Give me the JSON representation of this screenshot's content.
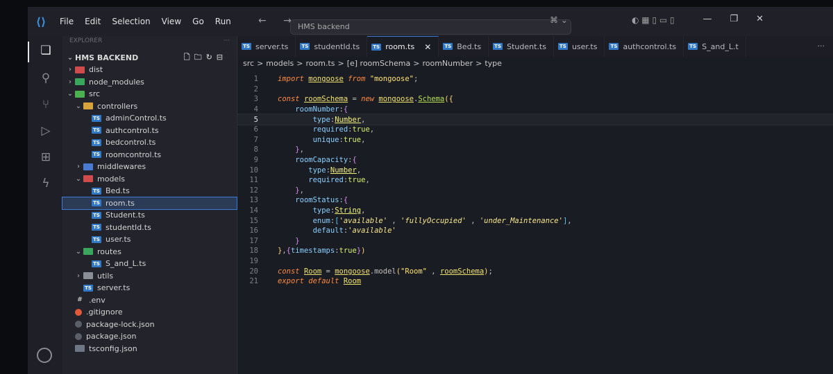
{
  "menu": [
    "File",
    "Edit",
    "Selection",
    "View",
    "Go",
    "Run"
  ],
  "titlebar": {
    "search_text": "HMS backend",
    "nav": "← →"
  },
  "sidebar": {
    "header": "EXPLORER",
    "more": "···",
    "root": "HMS BACKEND",
    "tree": [
      {
        "label": "dist",
        "depth": 0,
        "chev": "›",
        "icon": "folder red"
      },
      {
        "label": "node_modules",
        "depth": 0,
        "chev": "›",
        "icon": "folder green"
      },
      {
        "label": "src",
        "depth": 0,
        "chev": "⌄",
        "icon": "folder src"
      },
      {
        "label": "controllers",
        "depth": 1,
        "chev": "⌄",
        "icon": "folder yellow"
      },
      {
        "label": "adminControl.ts",
        "depth": 2,
        "chev": "",
        "icon": "ts"
      },
      {
        "label": "authcontrol.ts",
        "depth": 2,
        "chev": "",
        "icon": "ts"
      },
      {
        "label": "bedcontrol.ts",
        "depth": 2,
        "chev": "",
        "icon": "ts"
      },
      {
        "label": "roomcontrol.ts",
        "depth": 2,
        "chev": "",
        "icon": "ts"
      },
      {
        "label": "middlewares",
        "depth": 1,
        "chev": "›",
        "icon": "folder blue"
      },
      {
        "label": "models",
        "depth": 1,
        "chev": "⌄",
        "icon": "folder red"
      },
      {
        "label": "Bed.ts",
        "depth": 2,
        "chev": "",
        "icon": "ts"
      },
      {
        "label": "room.ts",
        "depth": 2,
        "chev": "",
        "icon": "ts",
        "selected": true
      },
      {
        "label": "Student.ts",
        "depth": 2,
        "chev": "",
        "icon": "ts"
      },
      {
        "label": "studentId.ts",
        "depth": 2,
        "chev": "",
        "icon": "ts"
      },
      {
        "label": "user.ts",
        "depth": 2,
        "chev": "",
        "icon": "ts"
      },
      {
        "label": "routes",
        "depth": 1,
        "chev": "⌄",
        "icon": "folder green"
      },
      {
        "label": "S_and_L.ts",
        "depth": 2,
        "chev": "",
        "icon": "ts"
      },
      {
        "label": "utils",
        "depth": 1,
        "chev": "›",
        "icon": "folder gray"
      },
      {
        "label": "server.ts",
        "depth": 1,
        "chev": "",
        "icon": "ts"
      },
      {
        "label": ".env",
        "depth": 0,
        "chev": "",
        "icon": "env"
      },
      {
        "label": ".gitignore",
        "depth": 0,
        "chev": "",
        "icon": "git"
      },
      {
        "label": "package-lock.json",
        "depth": 0,
        "chev": "",
        "icon": "json"
      },
      {
        "label": "package.json",
        "depth": 0,
        "chev": "",
        "icon": "json"
      },
      {
        "label": "tsconfig.json",
        "depth": 0,
        "chev": "",
        "icon": "cfg"
      }
    ]
  },
  "tabs": [
    {
      "label": "server.ts",
      "active": false
    },
    {
      "label": "studentId.ts",
      "active": false
    },
    {
      "label": "room.ts",
      "active": true
    },
    {
      "label": "Bed.ts",
      "active": false
    },
    {
      "label": "Student.ts",
      "active": false
    },
    {
      "label": "user.ts",
      "active": false
    },
    {
      "label": "authcontrol.ts",
      "active": false
    },
    {
      "label": "S_and_L.t",
      "active": false
    }
  ],
  "tab_close": "✕",
  "tab_more": "···",
  "breadcrumb": [
    "src",
    ">",
    "models",
    ">",
    "room.ts",
    ">",
    "[e] roomSchema",
    ">",
    "roomNumber",
    ">",
    "type"
  ],
  "editor": {
    "current_line": 5,
    "lines": [
      [
        [
          "kw",
          "import "
        ],
        [
          "var",
          "mongoose"
        ],
        [
          "kw",
          " from "
        ],
        [
          "str",
          "\"mongoose\""
        ],
        [
          "pun",
          ";"
        ]
      ],
      [],
      [
        [
          "kw",
          "const "
        ],
        [
          "var",
          "roomSchema"
        ],
        [
          "pun",
          " = "
        ],
        [
          "kw",
          "new "
        ],
        [
          "var",
          "mongoose"
        ],
        [
          "pun",
          "."
        ],
        [
          "fn",
          "Schema"
        ],
        [
          "brace",
          "({"
        ]
      ],
      [
        [
          "pun",
          "    "
        ],
        [
          "key",
          "roomNumber"
        ],
        [
          "pun",
          ":"
        ],
        [
          "brace2",
          "{"
        ]
      ],
      [
        [
          "pun",
          "        "
        ],
        [
          "key",
          "type"
        ],
        [
          "pun",
          ":"
        ],
        [
          "type",
          "Number"
        ],
        [
          "pun",
          ","
        ]
      ],
      [
        [
          "pun",
          "        "
        ],
        [
          "key",
          "required"
        ],
        [
          "pun",
          ":"
        ],
        [
          "bool",
          "true"
        ],
        [
          "pun",
          ","
        ]
      ],
      [
        [
          "pun",
          "        "
        ],
        [
          "key",
          "unique"
        ],
        [
          "pun",
          ":"
        ],
        [
          "bool",
          "true"
        ],
        [
          "pun",
          ","
        ]
      ],
      [
        [
          "pun",
          "    "
        ],
        [
          "brace2",
          "}"
        ],
        [
          "pun",
          ","
        ]
      ],
      [
        [
          "pun",
          "    "
        ],
        [
          "key",
          "roomCapacity"
        ],
        [
          "pun",
          ":"
        ],
        [
          "brace2",
          "{"
        ]
      ],
      [
        [
          "pun",
          "       "
        ],
        [
          "key",
          "type"
        ],
        [
          "pun",
          ":"
        ],
        [
          "type",
          "Number"
        ],
        [
          "pun",
          ","
        ]
      ],
      [
        [
          "pun",
          "       "
        ],
        [
          "key",
          "required"
        ],
        [
          "pun",
          ":"
        ],
        [
          "bool",
          "true"
        ],
        [
          "pun",
          ","
        ]
      ],
      [
        [
          "pun",
          "    "
        ],
        [
          "brace2",
          "}"
        ],
        [
          "pun",
          ","
        ]
      ],
      [
        [
          "pun",
          "    "
        ],
        [
          "key",
          "roomStatus"
        ],
        [
          "pun",
          ":"
        ],
        [
          "brace2",
          "{"
        ]
      ],
      [
        [
          "pun",
          "        "
        ],
        [
          "key",
          "type"
        ],
        [
          "pun",
          ":"
        ],
        [
          "type",
          "String"
        ],
        [
          "pun",
          ","
        ]
      ],
      [
        [
          "pun",
          "        "
        ],
        [
          "key",
          "enum"
        ],
        [
          "pun",
          ":"
        ],
        [
          "brace3",
          "["
        ],
        [
          "strq",
          "'available'"
        ],
        [
          "pun",
          " , "
        ],
        [
          "strq",
          "'fullyOccupied'"
        ],
        [
          "pun",
          " , "
        ],
        [
          "strq",
          "'under_Maintenance'"
        ],
        [
          "brace3",
          "]"
        ],
        [
          "pun",
          ","
        ]
      ],
      [
        [
          "pun",
          "        "
        ],
        [
          "key",
          "default"
        ],
        [
          "pun",
          ":"
        ],
        [
          "strq",
          "'available'"
        ]
      ],
      [
        [
          "pun",
          "    "
        ],
        [
          "brace2",
          "}"
        ]
      ],
      [
        [
          "brace",
          "}"
        ],
        [
          "pun",
          ","
        ],
        [
          "brace2",
          "{"
        ],
        [
          "key",
          "timestamps"
        ],
        [
          "pun",
          ":"
        ],
        [
          "bool",
          "true"
        ],
        [
          "brace2",
          "}"
        ],
        [
          "brace",
          ")"
        ]
      ],
      [],
      [
        [
          "kw",
          "const "
        ],
        [
          "var",
          "Room"
        ],
        [
          "pun",
          " = "
        ],
        [
          "var",
          "mongoose"
        ],
        [
          "pun",
          "."
        ],
        [
          "pun",
          "model"
        ],
        [
          "brace",
          "("
        ],
        [
          "str",
          "\"Room\""
        ],
        [
          "pun",
          " , "
        ],
        [
          "var",
          "roomSchema"
        ],
        [
          "brace",
          ")"
        ],
        [
          "pun",
          ";"
        ]
      ],
      [
        [
          "kw",
          "export default "
        ],
        [
          "var",
          "Room"
        ]
      ]
    ]
  }
}
